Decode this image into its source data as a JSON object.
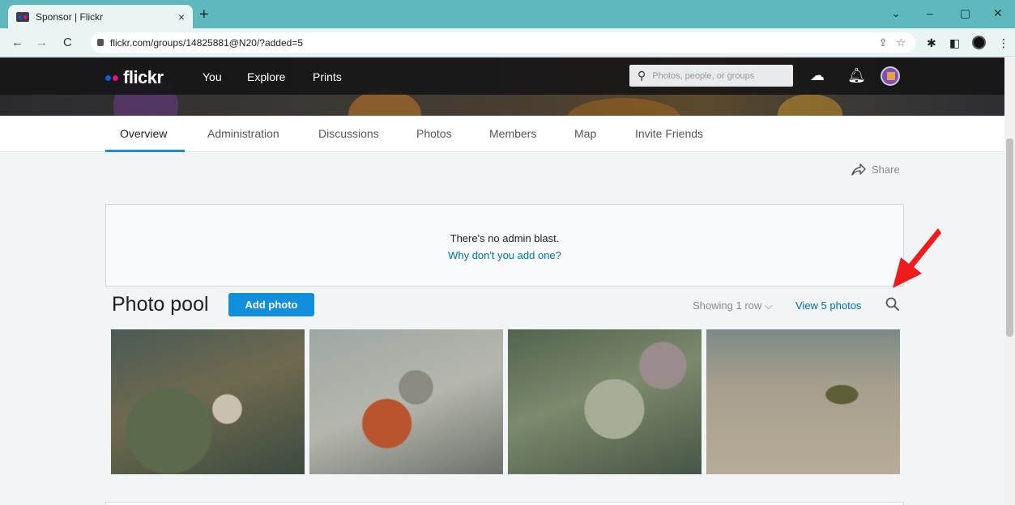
{
  "browser": {
    "tab_title": "Sponsor | Flickr",
    "tab_close": "×",
    "new_tab": "+",
    "url": "flickr.com/groups/14825881@N20/?added=5",
    "window_controls": [
      "⌄",
      "–",
      "▢",
      "✕"
    ]
  },
  "header": {
    "logo": "flickr",
    "nav": [
      "You",
      "Explore",
      "Prints"
    ],
    "search_placeholder": "Photos, people, or groups"
  },
  "subnav": {
    "tabs": [
      "Overview",
      "Administration",
      "Discussions",
      "Photos",
      "Members",
      "Map",
      "Invite Friends"
    ],
    "active": "Overview"
  },
  "share_label": "Share",
  "admin_blast": {
    "message": "There's no admin blast.",
    "link": "Why don't you add one?"
  },
  "pool": {
    "title": "Photo pool",
    "add_button": "Add photo",
    "showing": "Showing 1 row",
    "view_all": "View 5 photos"
  },
  "colors": {
    "accent": "#128fdc",
    "link": "#006dac",
    "annotation_arrow": "#ee1c1c"
  }
}
